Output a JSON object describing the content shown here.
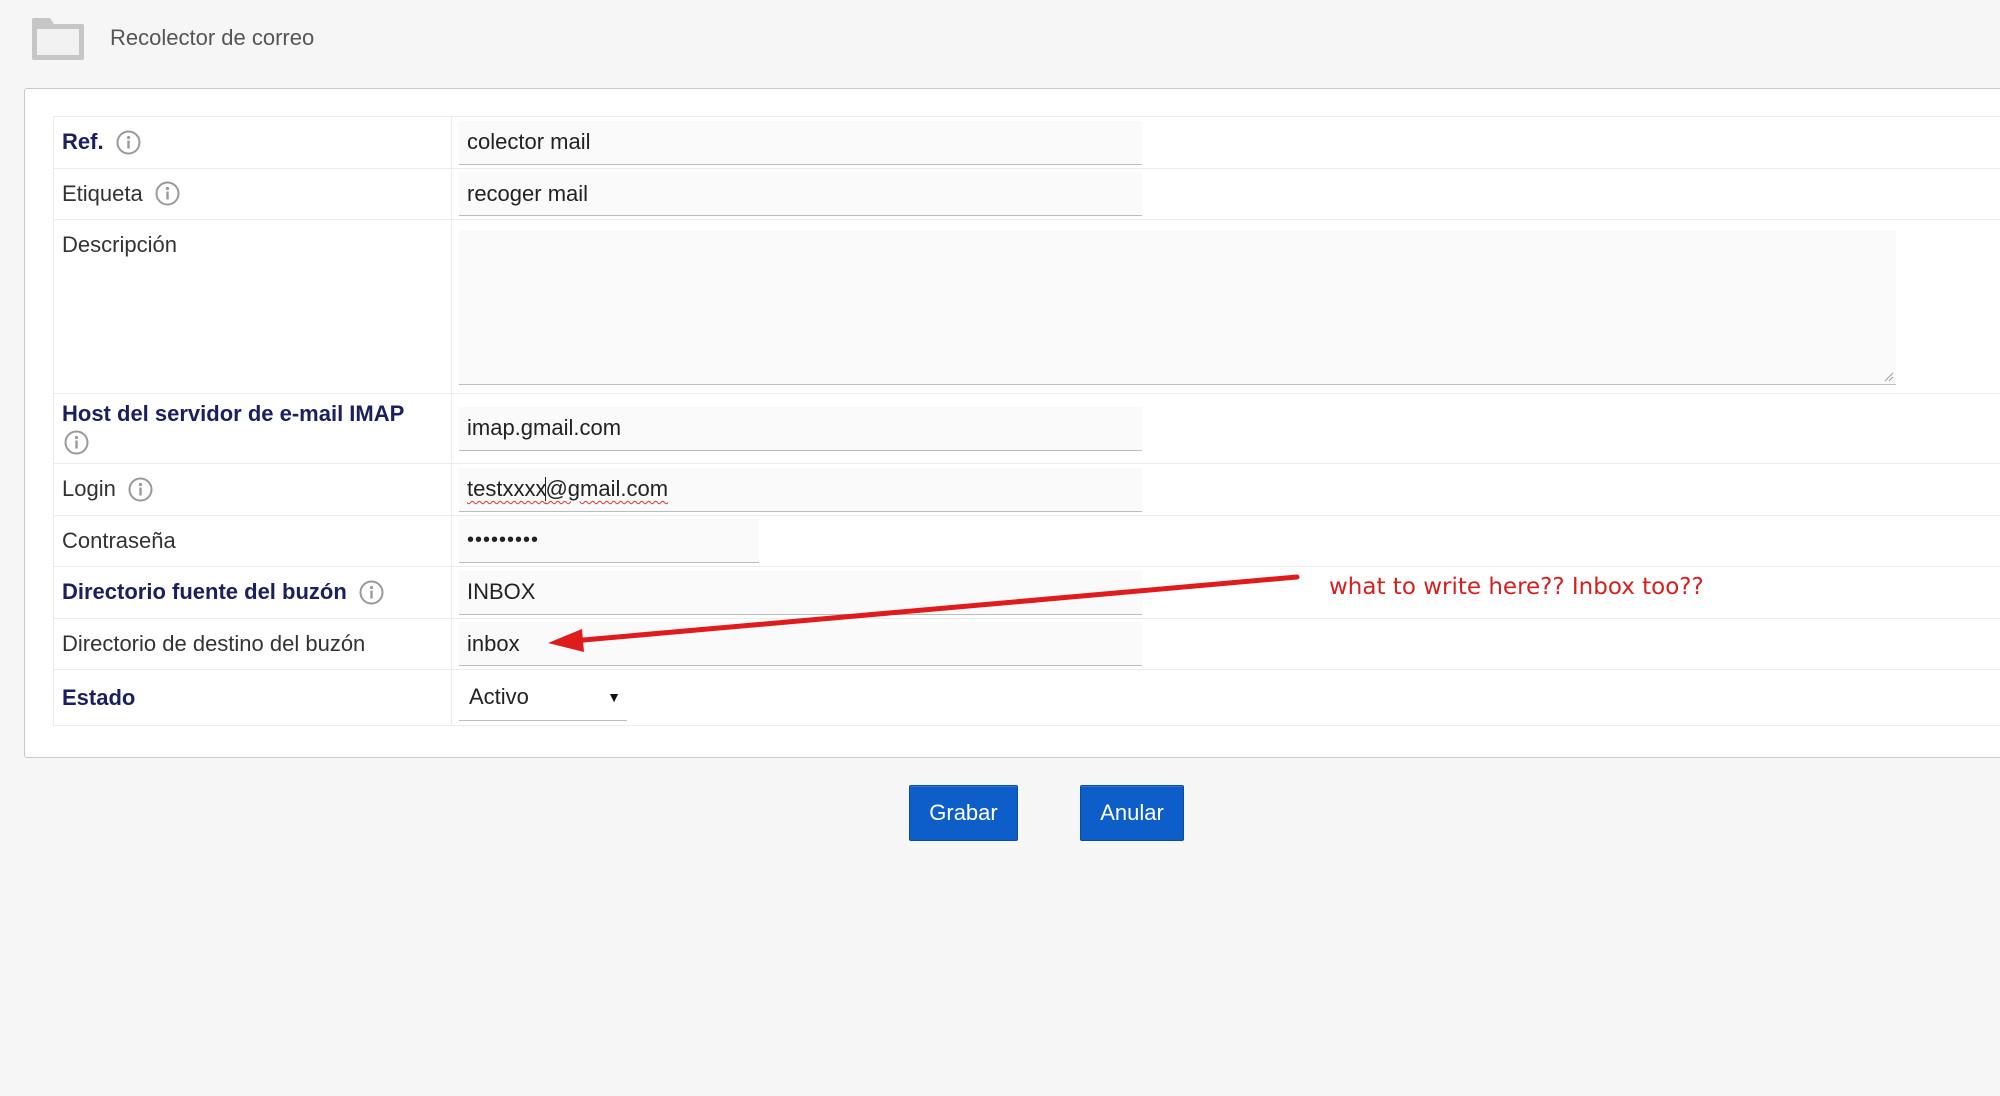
{
  "header": {
    "title": "Recolector de correo",
    "icon": "folder-icon"
  },
  "form": {
    "ref": {
      "label": "Ref.",
      "value": "colector mail"
    },
    "etiqueta": {
      "label": "Etiqueta",
      "value": "recoger mail"
    },
    "descripcion": {
      "label": "Descripción",
      "value": ""
    },
    "host": {
      "label": "Host del servidor de e-mail IMAP",
      "value": "imap.gmail.com"
    },
    "login": {
      "label": "Login",
      "value_part1": "testxxxx",
      "value_part2": "@gmail.com"
    },
    "password": {
      "label": "Contraseña",
      "value": "•••••••••"
    },
    "source_dir": {
      "label": "Directorio fuente del buzón",
      "value": "INBOX"
    },
    "target_dir": {
      "label": "Directorio de destino del buzón",
      "value": "inbox"
    },
    "estado": {
      "label": "Estado",
      "selected": "Activo"
    }
  },
  "buttons": {
    "save_label": "Grabar",
    "cancel_label": "Anular"
  },
  "annotation": {
    "text": "what to write here?? Inbox too??",
    "color": "#d62020"
  },
  "colors": {
    "button_bg": "#0d5ec9",
    "required_label": "#1a1f5e",
    "annotation": "#d62020"
  }
}
